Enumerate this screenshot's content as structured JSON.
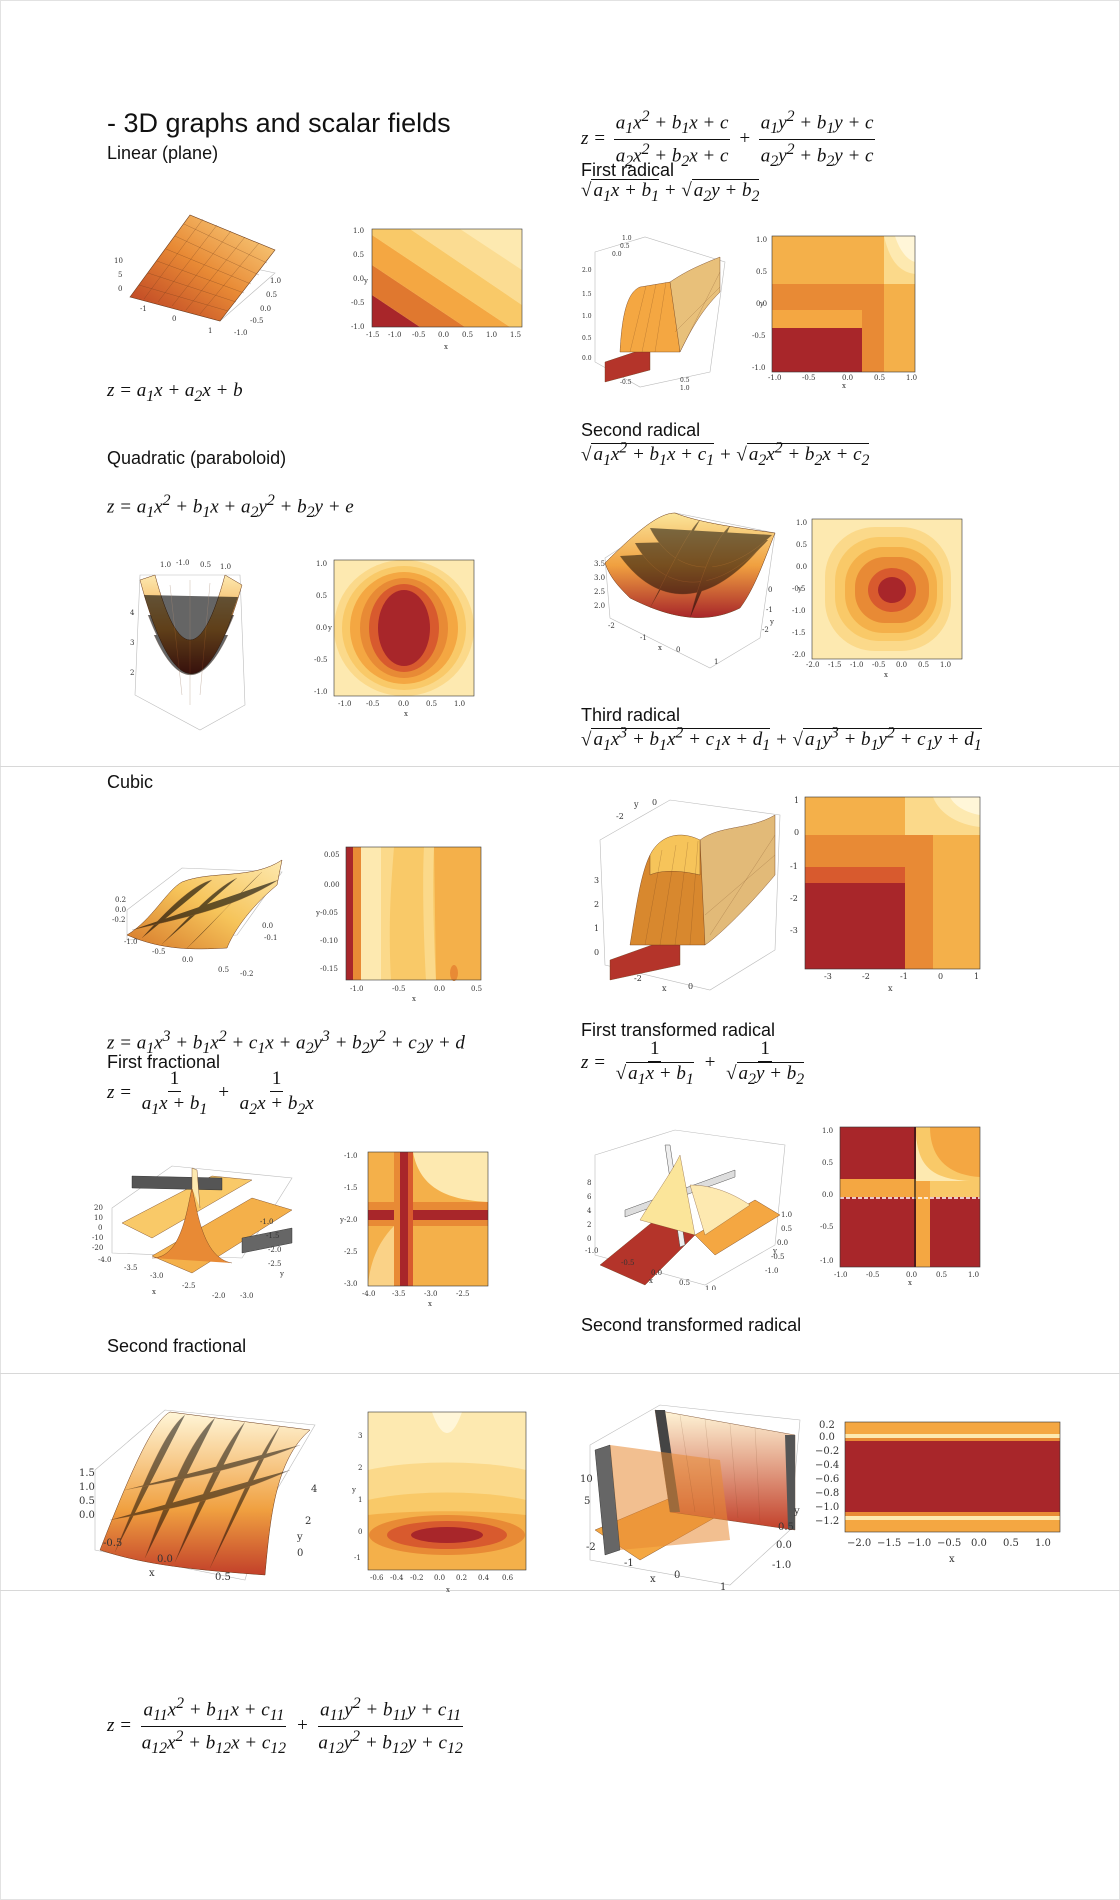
{
  "title": "- 3D graphs and scalar fields",
  "sections": {
    "linear": {
      "label": "Linear (plane)",
      "formula": "z = a1x + a2x + b"
    },
    "quadratic": {
      "label": "Quadratic (paraboloid)",
      "formula": "z = a1x² + b1x + a2y² + b2y + e"
    },
    "cubic": {
      "label": "Cubic",
      "formula": "z = a1x³ + b1x² + c1x + a2y³ + b2y² + c2y + d"
    },
    "first_fractional": {
      "label": "First fractional",
      "formula": "z = 1/(a1x + b1) + 1/(a2x + b2x)"
    },
    "second_fractional": {
      "label": "Second fractional",
      "formula": "z = (a1x² + b1x + c)/(a2x² + b2x + c) + (a1y² + b1y + c)/(a2y² + b2y + c)"
    },
    "first_radical": {
      "label": "First radical",
      "formula": "√(a1x + b1) + √(a2y + b2)"
    },
    "second_radical": {
      "label": "Second radical",
      "formula": "√(a1x² + b1x + c1) + √(a2x² + b2x + c2)"
    },
    "third_radical": {
      "label": "Third radical",
      "formula": "√(a1x³ + b1x² + c1x + d1) + √(a1y³ + b1y² + c1y + d1)"
    },
    "first_transformed_radical": {
      "label": "First transformed radical",
      "formula": "z = 1/√(a1x + b1) + 1/√(a2y + b2)"
    },
    "second_transformed_radical": {
      "label": "Second transformed radical",
      "formula": "z = (a11x² + b11x + c11)/(a12x² + b12x + c12) + (a11y² + b11y + c11)/(a12y² + b12y + c12)"
    }
  },
  "palette": {
    "dark": "#a8262a",
    "mid1": "#d85a2e",
    "mid2": "#e88a35",
    "mid3": "#f4b04a",
    "light1": "#f9d27a",
    "light2": "#fde9b0",
    "pale": "#fff6d8"
  },
  "ticks": {
    "linear_contour_x": [
      "-1.5",
      "-1.0",
      "-0.5",
      "0.0",
      "0.5",
      "1.0",
      "1.5"
    ],
    "linear_contour_y": [
      "1.0",
      "0.5",
      "0.0",
      "-0.5",
      "-1.0"
    ],
    "linear_surface": [
      "10",
      "5",
      "0",
      "-1",
      "0",
      "1",
      "1.0",
      "0.5",
      "0.0",
      "-0.5",
      "-1.0"
    ],
    "quad_contour_x": [
      "-1.0",
      "-0.5",
      "0.0",
      "0.5",
      "1.0"
    ],
    "quad_contour_y": [
      "1.0",
      "0.5",
      "0.0",
      "-0.5",
      "-1.0"
    ],
    "cubic_contour_x": [
      "-1.0",
      "-0.5",
      "0.0",
      "0.5"
    ],
    "cubic_contour_y": [
      "0.05",
      "0.00",
      "-0.05",
      "-0.10",
      "-0.15"
    ],
    "cubic_surface": [
      "0.2",
      "0.0",
      "-0.2",
      "-1.0",
      "-0.5",
      "0.0",
      "0.5",
      "0.0",
      "-0.1",
      "-0.2"
    ],
    "ff_contour_x": [
      "-4.0",
      "-3.5",
      "-3.0",
      "-2.5"
    ],
    "ff_contour_y": [
      "-1.0",
      "-1.5",
      "-2.0",
      "-2.5",
      "-3.0"
    ],
    "ff_surface": [
      "20",
      "10",
      "0",
      "-10",
      "-20",
      "-4.0",
      "-3.5",
      "-3.0",
      "-2.5",
      "-2.0",
      "-1.0",
      "-1.5",
      "-2.0",
      "-2.5",
      "-3.0"
    ],
    "sf_contour_x": [
      "-0.6",
      "-0.4",
      "-0.2",
      "0.0",
      "0.2",
      "0.4",
      "0.6"
    ],
    "sf_contour_y": [
      "3",
      "2",
      "1",
      "0",
      "-1"
    ],
    "sf_surface": [
      "1.5",
      "1.0",
      "0.5",
      "0.0",
      "-0.5",
      "0.0",
      "0.5",
      "4",
      "2",
      "0"
    ],
    "fr_contour_x": [
      "-1.0",
      "-0.5",
      "0.0",
      "0.5",
      "1.0"
    ],
    "fr_contour_y": [
      "1.0",
      "0.5",
      "0.0",
      "-0.5",
      "-1.0"
    ],
    "sr_contour_x": [
      "-2.0",
      "-1.5",
      "-1.0",
      "-0.5",
      "0.0",
      "0.5",
      "1.0"
    ],
    "sr_contour_y": [
      "1.0",
      "0.5",
      "0.0",
      "-0.5",
      "-1.0",
      "-1.5",
      "-2.0"
    ],
    "sr_surface": [
      "3.5",
      "3.0",
      "2.5",
      "2.0",
      "-2",
      "-1",
      "0",
      "1",
      "0",
      "-1",
      "-2"
    ],
    "tr_contour_x": [
      "-3",
      "-2",
      "-1",
      "0",
      "1"
    ],
    "tr_contour_y": [
      "1",
      "0",
      "-1",
      "-2",
      "-3"
    ],
    "tr_surface": [
      "3",
      "2",
      "1",
      "0",
      "-2",
      "0",
      "0",
      "-2"
    ],
    "ftr_contour_x": [
      "-1.0",
      "-0.5",
      "0.0",
      "0.5",
      "1.0"
    ],
    "ftr_contour_y": [
      "1.0",
      "0.5",
      "0.0",
      "-0.5",
      "-1.0"
    ],
    "ftr_surface": [
      "8",
      "6",
      "4",
      "2",
      "0",
      "-1.0",
      "-0.5",
      "0.0",
      "0.5",
      "1.0",
      "1.0",
      "0.5",
      "0.0",
      "-0.5",
      "-1.0"
    ],
    "str_contour_x": [
      "-2.0",
      "-1.5",
      "-1.0",
      "-0.5",
      "0.0",
      "0.5",
      "1.0"
    ],
    "str_contour_y": [
      "0.2",
      "0.0",
      "-0.2",
      "-0.4",
      "-0.6",
      "-0.8",
      "-1.0",
      "-1.2"
    ],
    "str_surface": [
      "10",
      "5",
      "-2",
      "-1",
      "0",
      "1",
      "0.5",
      "0.0",
      "-0.5",
      "-1.0"
    ]
  },
  "axis": {
    "x": "x",
    "y": "y"
  }
}
